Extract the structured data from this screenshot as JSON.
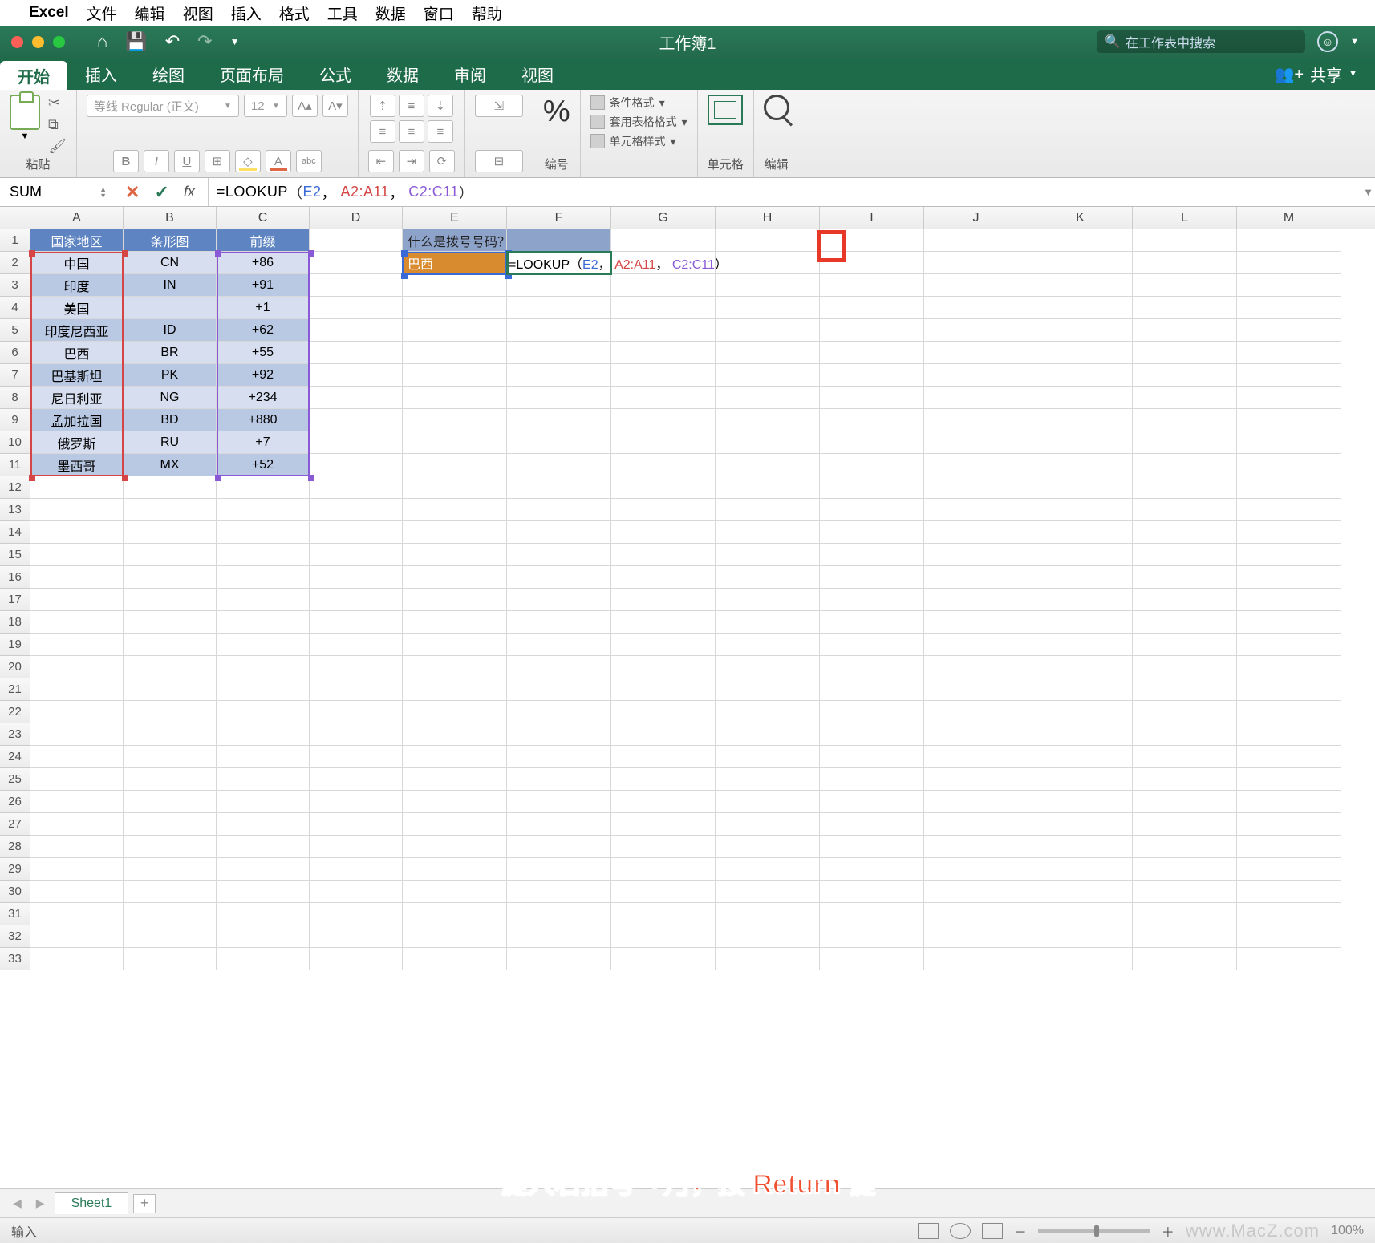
{
  "mac_menu": {
    "app": "Excel",
    "items": [
      "文件",
      "编辑",
      "视图",
      "插入",
      "格式",
      "工具",
      "数据",
      "窗口",
      "帮助"
    ]
  },
  "titlebar": {
    "doc_title": "工作簿1",
    "search_placeholder": "在工作表中搜索"
  },
  "ribbon_tabs": [
    "开始",
    "插入",
    "绘图",
    "页面布局",
    "公式",
    "数据",
    "审阅",
    "视图"
  ],
  "share_label": "共享",
  "ribbon": {
    "paste_label": "粘贴",
    "font_name": "等线 Regular (正文)",
    "font_size": "12",
    "number_label": "编号",
    "cond_fmt": "条件格式",
    "table_fmt": "套用表格格式",
    "cell_fmt": "单元格样式",
    "cells_label": "单元格",
    "edit_label": "编辑"
  },
  "formula_bar": {
    "name_box": "SUM",
    "formula_text": "=LOOKUP（E2，A2:A11，C2:C11）",
    "formula_parts": {
      "fn": "=LOOKUP",
      "open": "（",
      "a": "E2",
      "c1": "，",
      "b": "A2:A11",
      "c2": "，",
      "cc": "C2:C11",
      "close": "）"
    }
  },
  "columns": [
    "A",
    "B",
    "C",
    "D",
    "E",
    "F",
    "G",
    "H",
    "I",
    "J",
    "K",
    "L",
    "M"
  ],
  "table": {
    "headers": {
      "A": "国家地区",
      "B": "条形图",
      "C": "前缀"
    },
    "rows": [
      {
        "A": "中国",
        "B": "CN",
        "C": "+86"
      },
      {
        "A": "印度",
        "B": "IN",
        "C": "+91"
      },
      {
        "A": "美国",
        "B": "",
        "C": "+1"
      },
      {
        "A": "印度尼西亚",
        "B": "ID",
        "C": "+62"
      },
      {
        "A": "巴西",
        "B": "BR",
        "C": "+55"
      },
      {
        "A": "巴基斯坦",
        "B": "PK",
        "C": "+92"
      },
      {
        "A": "尼日利亚",
        "B": "NG",
        "C": "+234"
      },
      {
        "A": "孟加拉国",
        "B": "BD",
        "C": "+880"
      },
      {
        "A": "俄罗斯",
        "B": "RU",
        "C": "+7"
      },
      {
        "A": "墨西哥",
        "B": "MX",
        "C": "+52"
      }
    ]
  },
  "lookup_area": {
    "question": "什么是拨号号码？",
    "e2_value": "巴西",
    "f2_formula_parts": {
      "fn": "=LOOKUP",
      "open": "（",
      "a": "E2",
      "c1": "，",
      "b": "A2:A11",
      "c2": "，",
      "cc": "C2:C11",
      "close": "）"
    }
  },
  "visible_rows": 33,
  "sheet_tabs": {
    "active": "Sheet1"
  },
  "overlay_instruction": "键入右括号「）」，按 Return 键",
  "statusbar": {
    "mode": "输入",
    "zoom": "100%",
    "watermark": "www.MacZ.com"
  }
}
